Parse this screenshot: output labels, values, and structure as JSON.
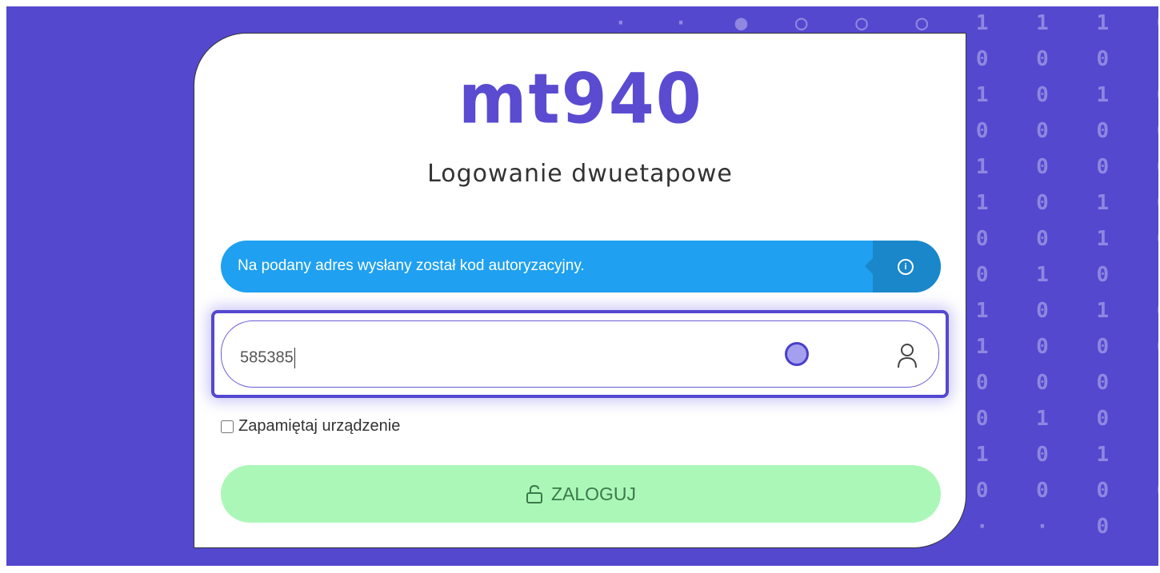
{
  "brand": {
    "logo_text": "mt940",
    "accent_color": "#5448cf"
  },
  "page": {
    "title": "Logowanie dwuetapowe"
  },
  "alert": {
    "message": "Na podany adres wysłany został kod autoryzacyjny.",
    "icon": "info-icon",
    "color": "#1fa0f0"
  },
  "code_field": {
    "value": "585385",
    "icon": "user-icon"
  },
  "remember": {
    "label": "Zapamiętaj urządzenie",
    "checked": false
  },
  "login_button": {
    "label": "ZALOGUJ",
    "icon": "lock-icon",
    "color": "#abf7b8"
  }
}
